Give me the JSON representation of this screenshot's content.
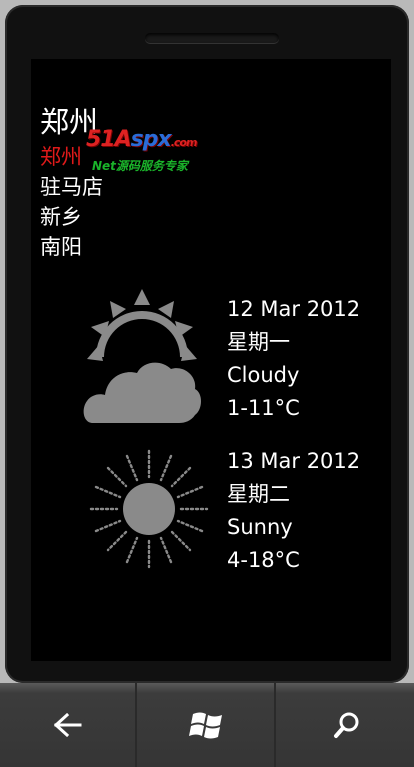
{
  "cities": [
    {
      "name": "郑州",
      "selected": false
    },
    {
      "name": "郑州",
      "selected": true
    },
    {
      "name": "驻马店",
      "selected": false
    },
    {
      "name": "新乡",
      "selected": false
    },
    {
      "name": "南阳",
      "selected": false
    }
  ],
  "watermark": {
    "logo_a": "51A",
    "logo_b": "spx",
    "logo_c": ".com",
    "sub": "Net源码服务专家"
  },
  "forecast": [
    {
      "date": "12 Mar 2012",
      "weekday": "星期一",
      "condition": "Cloudy",
      "temp": "1-11°C",
      "icon": "cloudy-icon"
    },
    {
      "date": "13 Mar 2012",
      "weekday": "星期二",
      "condition": "Sunny",
      "temp": "4-18°C",
      "icon": "sunny-icon"
    }
  ],
  "nav": {
    "back": "back-arrow-icon",
    "start": "windows-logo-icon",
    "search": "search-icon"
  },
  "colors": {
    "screen_bg": "#000000",
    "selected_city": "#e01a1a",
    "icon_gray": "#8a8a8a"
  }
}
